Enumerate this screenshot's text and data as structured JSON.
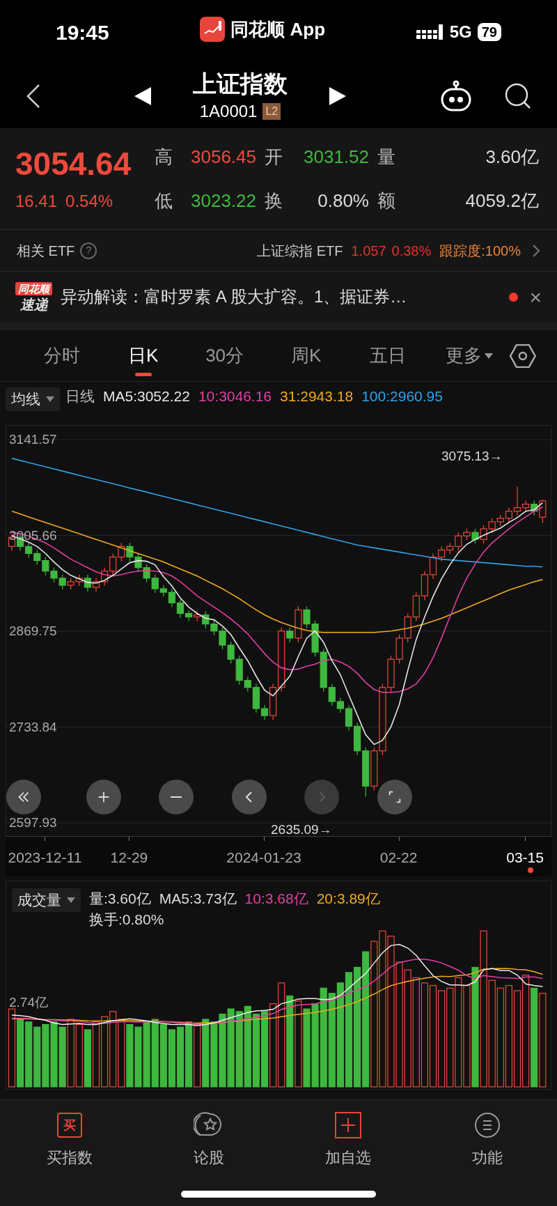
{
  "status_bar": {
    "time": "19:45",
    "app": "同花顺 App",
    "network": "5G",
    "battery": "79"
  },
  "header": {
    "title": "上证指数",
    "code": "1A0001",
    "badge": "L2"
  },
  "quote": {
    "price": "3054.64",
    "change": "16.41",
    "change_pct": "0.54%",
    "color": "#f04a3c",
    "stats": [
      {
        "label": "高",
        "value": "3056.45",
        "color": "#f04a3c"
      },
      {
        "label": "开",
        "value": "3031.52",
        "color": "#3fb83f"
      },
      {
        "label": "量",
        "value": "3.60亿",
        "color": "#dddddd"
      },
      {
        "label": "低",
        "value": "3023.22",
        "color": "#3fb83f"
      },
      {
        "label": "换",
        "value": "0.80%",
        "color": "#dddddd"
      },
      {
        "label": "额",
        "value": "4059.2亿",
        "color": "#dddddd"
      }
    ]
  },
  "etf": {
    "label": "相关 ETF",
    "help": "?",
    "name": "上证综指 ETF",
    "price": "1.057",
    "pct": "0.38%",
    "tracking": "跟踪度:100%"
  },
  "news": {
    "logo_top": "同花顺",
    "logo_bottom": "速递",
    "text": "异动解读：富时罗素 A 股大扩容。1、据证券…",
    "unread": true,
    "close": "×"
  },
  "tabs": [
    {
      "label": "分时",
      "selected": false,
      "kind": "tab"
    },
    {
      "label": "日K",
      "selected": true,
      "kind": "tab"
    },
    {
      "label": "30分",
      "selected": false,
      "kind": "tab"
    },
    {
      "label": "周K",
      "selected": false,
      "kind": "tab"
    },
    {
      "label": "五日",
      "selected": false,
      "kind": "tab"
    },
    {
      "label": "更多",
      "selected": false,
      "kind": "menu"
    }
  ],
  "ma_legend": {
    "selector": "均线",
    "items": [
      {
        "text": "日线",
        "color": "#bbbbbb"
      },
      {
        "text": "MA5:3052.22",
        "color": "#e6e6e6"
      },
      {
        "text": "10:3046.16",
        "color": "#e23fa6"
      },
      {
        "text": "31:2943.18",
        "color": "#f2a91e"
      },
      {
        "text": "100:2960.95",
        "color": "#2ea3e6"
      }
    ]
  },
  "price_chart": {
    "high_marker": "3075.13→",
    "low_marker": "2635.09→",
    "today_marker": true,
    "controls": [
      {
        "kind": "first",
        "disabled": false
      },
      {
        "kind": "zoom-in",
        "disabled": false
      },
      {
        "kind": "zoom-out",
        "disabled": false
      },
      {
        "kind": "prev",
        "disabled": false
      },
      {
        "kind": "next",
        "disabled": true
      },
      {
        "kind": "fullscreen",
        "disabled": false
      }
    ],
    "chart_data": {
      "type": "candlestick",
      "grid": true,
      "ylim": [
        2597.93,
        3141.57
      ],
      "series": [
        {
          "type": "line",
          "color": "#2ea3e6",
          "values": [
            3115,
            3112,
            3109,
            3106,
            3103,
            3100,
            3097,
            3094,
            3091,
            3088,
            3085,
            3082,
            3079,
            3076,
            3073,
            3070,
            3067,
            3064,
            3061,
            3058,
            3055,
            3052,
            3049,
            3046,
            3043,
            3040,
            3037,
            3034,
            3031,
            3028,
            3025,
            3022,
            3019,
            3016,
            3013,
            3010,
            3007,
            3004,
            3001,
            2998,
            2995,
            2992,
            2990,
            2988,
            2986,
            2984,
            2982,
            2980,
            2978,
            2976,
            2974,
            2972,
            2971,
            2970,
            2969,
            2968,
            2967,
            2966,
            2965,
            2964,
            2963,
            2962,
            2962,
            2961
          ]
        },
        {
          "type": "line",
          "color": "#f2a91e",
          "values": [
            3040,
            3036,
            3032,
            3028,
            3024,
            3020,
            3016,
            3012,
            3008,
            3004,
            3000,
            2996,
            2992,
            2988,
            2984,
            2980,
            2976,
            2972,
            2968,
            2963,
            2958,
            2953,
            2948,
            2942,
            2936,
            2930,
            2923,
            2916,
            2908,
            2900,
            2893,
            2887,
            2882,
            2878,
            2874,
            2871,
            2869,
            2868,
            2868,
            2868,
            2868,
            2868,
            2868,
            2868,
            2869,
            2870,
            2872,
            2874,
            2877,
            2880,
            2884,
            2888,
            2893,
            2898,
            2903,
            2908,
            2913,
            2918,
            2923,
            2928,
            2932,
            2936,
            2940,
            2943
          ]
        },
        {
          "type": "line",
          "color": "#e23fa6",
          "values": [
            3010,
            3008,
            3005,
            3000,
            2995,
            2988,
            2980,
            2972,
            2966,
            2960,
            2954,
            2950,
            2948,
            2950,
            2953,
            2955,
            2956,
            2955,
            2953,
            2948,
            2940,
            2930,
            2920,
            2912,
            2904,
            2896,
            2887,
            2877,
            2866,
            2852,
            2838,
            2826,
            2818,
            2815,
            2816,
            2820,
            2823,
            2828,
            2830,
            2826,
            2820,
            2810,
            2797,
            2787,
            2783,
            2783,
            2784,
            2788,
            2795,
            2810,
            2832,
            2860,
            2890,
            2920,
            2945,
            2965,
            2982,
            2995,
            3005,
            3015,
            3024,
            3032,
            3040,
            3046
          ]
        },
        {
          "type": "line",
          "color": "#e6e6e6",
          "values": [
            3005,
            3001,
            2996,
            2990,
            2980,
            2968,
            2957,
            2949,
            2944,
            2939,
            2938,
            2942,
            2949,
            2958,
            2967,
            2970,
            2969,
            2964,
            2947,
            2934,
            2917,
            2904,
            2895,
            2888,
            2886,
            2877,
            2865,
            2846,
            2828,
            2806,
            2786,
            2778,
            2792,
            2806,
            2834,
            2860,
            2870,
            2854,
            2828,
            2808,
            2779,
            2751,
            2723,
            2709,
            2715,
            2734,
            2766,
            2814,
            2858,
            2890,
            2919,
            2944,
            2964,
            2981,
            2993,
            3000,
            3006,
            3011,
            3016,
            3024,
            3031,
            3040,
            3042,
            3052
          ]
        }
      ],
      "yticks": [
        {
          "value": 3141.57,
          "label": "3141.57"
        },
        {
          "value": 3005.66,
          "label": "3005.66"
        },
        {
          "value": 2869.75,
          "label": "2869.75"
        },
        {
          "value": 2733.84,
          "label": "2733.84"
        },
        {
          "value": 2597.93,
          "label": "2597.93"
        }
      ],
      "categories": [
        null,
        null,
        null,
        null,
        "2023-12-11",
        null,
        null,
        null,
        null,
        null,
        null,
        null,
        null,
        null,
        "12-29",
        null,
        null,
        null,
        null,
        null,
        null,
        null,
        null,
        null,
        null,
        null,
        null,
        null,
        null,
        null,
        "2024-01-23",
        null,
        null,
        null,
        null,
        null,
        null,
        null,
        null,
        null,
        null,
        null,
        null,
        null,
        null,
        null,
        "02-22",
        null,
        null,
        null,
        null,
        null,
        null,
        null,
        null,
        null,
        null,
        null,
        null,
        null,
        null,
        "03-15",
        null,
        null
      ],
      "ohlc": [
        [
          2990,
          3008,
          2984,
          3003
        ],
        [
          3003,
          3008,
          2984,
          2990
        ],
        [
          2990,
          2995,
          2974,
          2980
        ],
        [
          2980,
          2985,
          2964,
          2970
        ],
        [
          2970,
          2975,
          2949,
          2955
        ],
        [
          2955,
          2960,
          2939,
          2945
        ],
        [
          2945,
          2950,
          2929,
          2935
        ],
        [
          2935,
          2945,
          2929,
          2940
        ],
        [
          2940,
          2950,
          2934,
          2945
        ],
        [
          2945,
          2950,
          2926,
          2932
        ],
        [
          2932,
          2945,
          2926,
          2940
        ],
        [
          2940,
          2960,
          2934,
          2955
        ],
        [
          2955,
          2980,
          2949,
          2975
        ],
        [
          2975,
          2995,
          2969,
          2990
        ],
        [
          2990,
          2995,
          2969,
          2975
        ],
        [
          2975,
          2980,
          2954,
          2960
        ],
        [
          2960,
          2965,
          2939,
          2945
        ],
        [
          2945,
          2950,
          2924,
          2930
        ],
        [
          2930,
          2935,
          2919,
          2925
        ],
        [
          2925,
          2930,
          2904,
          2910
        ],
        [
          2910,
          2915,
          2889,
          2895
        ],
        [
          2895,
          2900,
          2884,
          2890
        ],
        [
          2890,
          2898,
          2884,
          2893
        ],
        [
          2893,
          2898,
          2874,
          2880
        ],
        [
          2880,
          2885,
          2864,
          2870
        ],
        [
          2870,
          2875,
          2844,
          2850
        ],
        [
          2850,
          2855,
          2824,
          2830
        ],
        [
          2830,
          2835,
          2794,
          2800
        ],
        [
          2800,
          2805,
          2784,
          2790
        ],
        [
          2790,
          2795,
          2754,
          2760
        ],
        [
          2760,
          2765,
          2744,
          2750
        ],
        [
          2750,
          2795,
          2744,
          2790
        ],
        [
          2790,
          2875,
          2784,
          2870
        ],
        [
          2870,
          2875,
          2854,
          2860
        ],
        [
          2860,
          2905,
          2854,
          2900
        ],
        [
          2900,
          2905,
          2874,
          2880
        ],
        [
          2880,
          2885,
          2834,
          2840
        ],
        [
          2840,
          2845,
          2784,
          2790
        ],
        [
          2790,
          2795,
          2764,
          2770
        ],
        [
          2770,
          2775,
          2754,
          2760
        ],
        [
          2760,
          2765,
          2729,
          2735
        ],
        [
          2735,
          2740,
          2694,
          2700
        ],
        [
          2700,
          2705,
          2635.09,
          2650
        ],
        [
          2650,
          2705,
          2644,
          2700
        ],
        [
          2700,
          2795,
          2694,
          2790
        ],
        [
          2790,
          2835,
          2784,
          2830
        ],
        [
          2830,
          2865,
          2824,
          2860
        ],
        [
          2860,
          2895,
          2854,
          2890
        ],
        [
          2890,
          2925,
          2884,
          2920
        ],
        [
          2920,
          2955,
          2914,
          2950
        ],
        [
          2950,
          2980,
          2944,
          2975
        ],
        [
          2975,
          2990,
          2969,
          2985
        ],
        [
          2985,
          2995,
          2979,
          2990
        ],
        [
          2990,
          3010,
          2984,
          3005
        ],
        [
          3005,
          3015,
          2999,
          3010
        ],
        [
          3010,
          3015,
          2994,
          3000
        ],
        [
          3000,
          3020,
          2994,
          3015
        ],
        [
          3015,
          3030,
          3009,
          3025
        ],
        [
          3025,
          3035,
          3019,
          3030
        ],
        [
          3030,
          3045,
          3024,
          3040
        ],
        [
          3040,
          3075.13,
          3034,
          3045
        ],
        [
          3045,
          3055,
          3039,
          3050
        ],
        [
          3050,
          3055,
          3034,
          3040
        ],
        [
          3031.52,
          3056.45,
          3023.22,
          3054.64
        ]
      ]
    }
  },
  "volume_chart": {
    "selector": "成交量",
    "legend": [
      {
        "text": "量:3.60亿",
        "color": "#dddddd"
      },
      {
        "text": "MA5:3.73亿",
        "color": "#dddddd"
      },
      {
        "text": "10:3.68亿",
        "color": "#e23fa6"
      },
      {
        "text": "20:3.89亿",
        "color": "#f2a91e"
      }
    ],
    "turnover": "换手:0.80%",
    "axis_label": "2.74亿"
  },
  "bottom_nav": [
    {
      "label": "买指数",
      "kind": "buy",
      "icon_text": "买"
    },
    {
      "label": "论股",
      "kind": "discuss"
    },
    {
      "label": "加自选",
      "kind": "add"
    },
    {
      "label": "功能",
      "kind": "menu"
    }
  ]
}
